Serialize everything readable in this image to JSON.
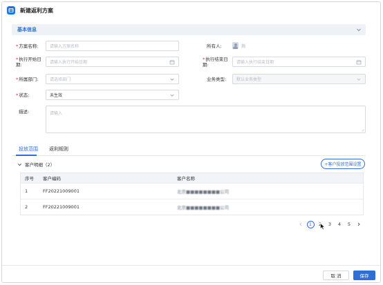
{
  "window": {
    "title": "新建返利方案"
  },
  "section": {
    "title": "基本信息"
  },
  "form": {
    "plan_name": {
      "label": "方案名称:",
      "placeholder": "请输入方案名称"
    },
    "owner": {
      "label": "所有人:",
      "name": "刘　"
    },
    "start_date": {
      "label_line1": "执行开始日",
      "label_line2": "期:",
      "placeholder": "请输入执行开始日期"
    },
    "end_date": {
      "label_line1": "执行结束日",
      "label_line2": "期:",
      "placeholder": "请输入执行结束日期"
    },
    "department": {
      "label": "所属部门:",
      "placeholder": "请选择部门"
    },
    "business_type": {
      "label": "业务类型:",
      "placeholder": "默认业务类型"
    },
    "status": {
      "label": "状态:",
      "value": "未生效"
    },
    "description": {
      "label": "描述:",
      "placeholder": "请输入"
    }
  },
  "tabs": [
    {
      "label": "投放范围",
      "active": true
    },
    {
      "label": "返利规则",
      "active": false
    }
  ],
  "customer_group": {
    "label": "客户明细（2）",
    "button": "+客户投放范围设置"
  },
  "table": {
    "headers": [
      "序号",
      "客户编码",
      "客户名称"
    ],
    "rows": [
      {
        "index": "1",
        "code": "FF20221009001",
        "name": "北京■■■■■■■■公司"
      },
      {
        "index": "2",
        "code": "FF20221009001",
        "name": "北京■■■■■■■■公司"
      }
    ]
  },
  "pagination": {
    "pages": [
      "1",
      "2",
      "3",
      "4",
      "5"
    ],
    "current": "1"
  },
  "footer": {
    "cancel": "取 消",
    "save": "保存"
  },
  "colors": {
    "accent": "#2d6fd6",
    "required": "#ee2233"
  },
  "icons": [
    "app-icon",
    "chevron-down-icon",
    "calendar-icon",
    "chevron-left-icon",
    "chevron-right-icon",
    "cursor-icon"
  ]
}
